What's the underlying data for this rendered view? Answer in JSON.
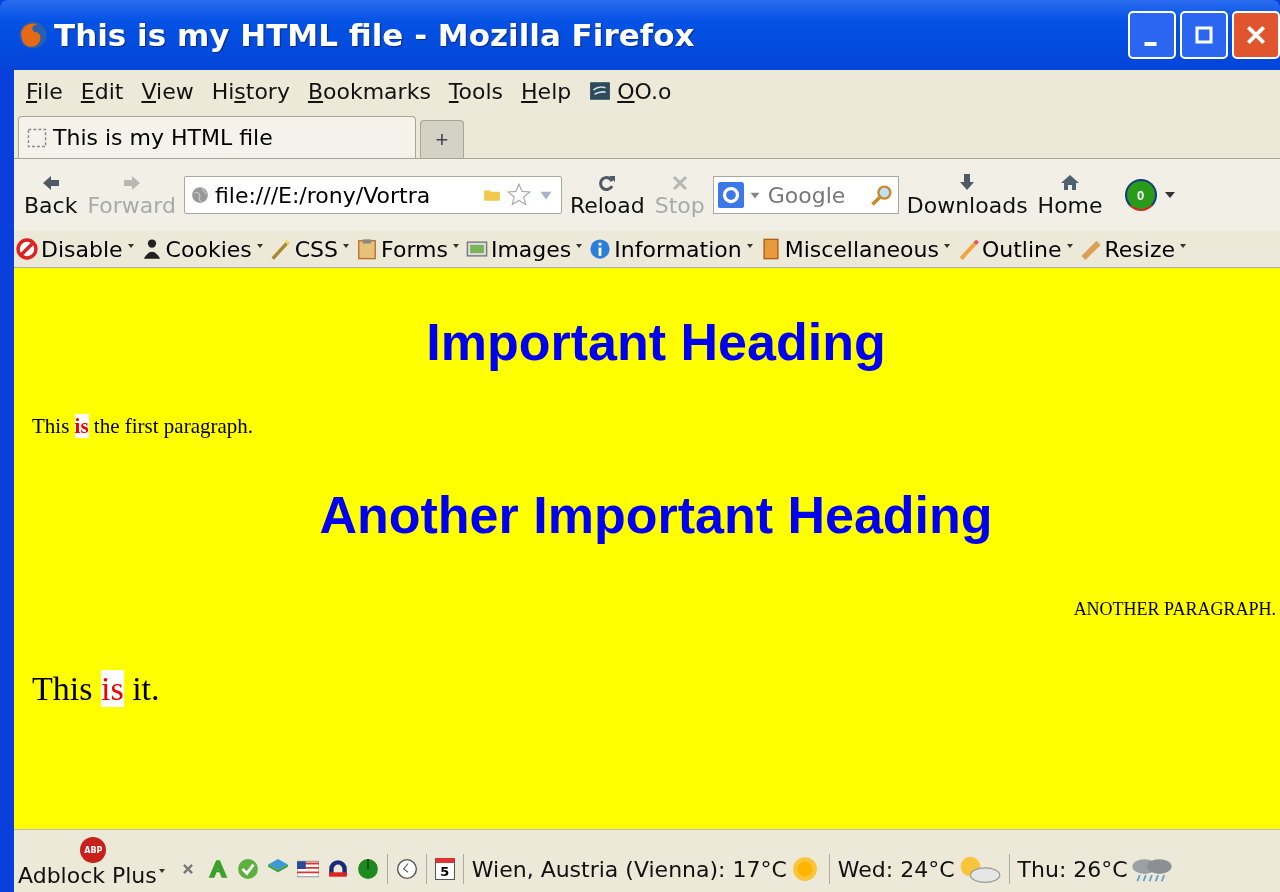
{
  "window": {
    "title": "This is my HTML file - Mozilla Firefox"
  },
  "menu": [
    {
      "key": "F",
      "post": "ile",
      "kind": "menu"
    },
    {
      "key": "E",
      "post": "dit",
      "kind": "menu"
    },
    {
      "key": "V",
      "post": "iew",
      "kind": "menu"
    },
    {
      "pre": "Hi",
      "key": "s",
      "post": "tory",
      "kind": "menu"
    },
    {
      "key": "B",
      "post": "ookmarks",
      "kind": "menu"
    },
    {
      "key": "T",
      "post": "ools",
      "kind": "menu"
    },
    {
      "key": "H",
      "post": "elp",
      "kind": "menu"
    },
    {
      "key": "O",
      "post": "O.o",
      "kind": "app"
    }
  ],
  "tabs": [
    {
      "label": "This is my HTML file",
      "selected": true
    }
  ],
  "new_tab": "+",
  "nav": [
    {
      "label": "Back",
      "disabled": false,
      "kind": "back"
    },
    {
      "label": "Forward",
      "disabled": true,
      "kind": "forward"
    }
  ],
  "url": "file:///E:/rony/Vortra",
  "nav2": [
    {
      "label": "Reload",
      "disabled": false,
      "kind": "reload"
    },
    {
      "label": "Stop",
      "disabled": true,
      "kind": "stop"
    }
  ],
  "search": {
    "placeholder": "Google"
  },
  "nav3": [
    {
      "label": "Downloads",
      "kind": "downloads"
    },
    {
      "label": "Home",
      "kind": "home"
    }
  ],
  "counter": "0",
  "devbar": [
    {
      "label": "Disable",
      "kind": "disable"
    },
    {
      "label": "Cookies",
      "kind": "cookies"
    },
    {
      "label": "CSS",
      "kind": "css"
    },
    {
      "label": "Forms",
      "kind": "forms"
    },
    {
      "label": "Images",
      "kind": "images"
    },
    {
      "label": "Information",
      "kind": "info"
    },
    {
      "label": "Miscellaneous",
      "kind": "misc"
    },
    {
      "label": "Outline",
      "kind": "outline"
    },
    {
      "label": "Resize",
      "kind": "resize"
    }
  ],
  "content": [
    {
      "kind": "heading",
      "parts": [
        {
          "text": "Important Heading",
          "highlight": false
        }
      ]
    },
    {
      "kind": "paragraph",
      "parts": [
        {
          "text": "This ",
          "highlight": false
        },
        {
          "text": "is",
          "highlight": true
        },
        {
          "text": " the first paragraph.",
          "highlight": false
        }
      ]
    },
    {
      "kind": "heading",
      "parts": [
        {
          "text": "Another Important Heading",
          "highlight": false
        }
      ]
    },
    {
      "kind": "right",
      "parts": [
        {
          "text": "ANOTHER PARAGRAPH.",
          "highlight": false
        }
      ]
    },
    {
      "kind": "large",
      "parts": [
        {
          "text": "This ",
          "highlight": false
        },
        {
          "text": "is",
          "highlight": true
        },
        {
          "text": " it.",
          "highlight": false
        }
      ]
    }
  ],
  "status": {
    "adblock_icon": "ABP",
    "adblock": "Adblock Plus",
    "calendar_day": "5",
    "weather": [
      {
        "text": "Wien, Austria (Vienna): 17°C",
        "kind": "sunny"
      },
      {
        "text": "Wed: 24°C",
        "kind": "partly-cloudy"
      },
      {
        "text": "Thu: 26°C",
        "kind": "rain"
      }
    ]
  }
}
